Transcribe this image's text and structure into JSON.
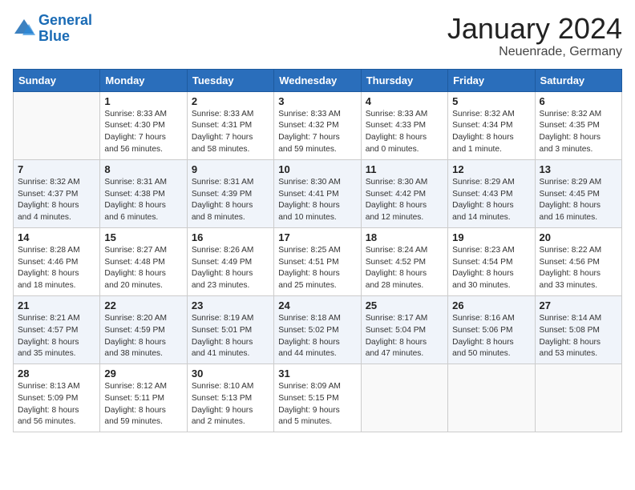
{
  "logo": {
    "line1": "General",
    "line2": "Blue"
  },
  "title": "January 2024",
  "location": "Neuenrade, Germany",
  "weekdays": [
    "Sunday",
    "Monday",
    "Tuesday",
    "Wednesday",
    "Thursday",
    "Friday",
    "Saturday"
  ],
  "weeks": [
    [
      {
        "day": "",
        "info": ""
      },
      {
        "day": "1",
        "info": "Sunrise: 8:33 AM\nSunset: 4:30 PM\nDaylight: 7 hours\nand 56 minutes."
      },
      {
        "day": "2",
        "info": "Sunrise: 8:33 AM\nSunset: 4:31 PM\nDaylight: 7 hours\nand 58 minutes."
      },
      {
        "day": "3",
        "info": "Sunrise: 8:33 AM\nSunset: 4:32 PM\nDaylight: 7 hours\nand 59 minutes."
      },
      {
        "day": "4",
        "info": "Sunrise: 8:33 AM\nSunset: 4:33 PM\nDaylight: 8 hours\nand 0 minutes."
      },
      {
        "day": "5",
        "info": "Sunrise: 8:32 AM\nSunset: 4:34 PM\nDaylight: 8 hours\nand 1 minute."
      },
      {
        "day": "6",
        "info": "Sunrise: 8:32 AM\nSunset: 4:35 PM\nDaylight: 8 hours\nand 3 minutes."
      }
    ],
    [
      {
        "day": "7",
        "info": "Sunrise: 8:32 AM\nSunset: 4:37 PM\nDaylight: 8 hours\nand 4 minutes."
      },
      {
        "day": "8",
        "info": "Sunrise: 8:31 AM\nSunset: 4:38 PM\nDaylight: 8 hours\nand 6 minutes."
      },
      {
        "day": "9",
        "info": "Sunrise: 8:31 AM\nSunset: 4:39 PM\nDaylight: 8 hours\nand 8 minutes."
      },
      {
        "day": "10",
        "info": "Sunrise: 8:30 AM\nSunset: 4:41 PM\nDaylight: 8 hours\nand 10 minutes."
      },
      {
        "day": "11",
        "info": "Sunrise: 8:30 AM\nSunset: 4:42 PM\nDaylight: 8 hours\nand 12 minutes."
      },
      {
        "day": "12",
        "info": "Sunrise: 8:29 AM\nSunset: 4:43 PM\nDaylight: 8 hours\nand 14 minutes."
      },
      {
        "day": "13",
        "info": "Sunrise: 8:29 AM\nSunset: 4:45 PM\nDaylight: 8 hours\nand 16 minutes."
      }
    ],
    [
      {
        "day": "14",
        "info": "Sunrise: 8:28 AM\nSunset: 4:46 PM\nDaylight: 8 hours\nand 18 minutes."
      },
      {
        "day": "15",
        "info": "Sunrise: 8:27 AM\nSunset: 4:48 PM\nDaylight: 8 hours\nand 20 minutes."
      },
      {
        "day": "16",
        "info": "Sunrise: 8:26 AM\nSunset: 4:49 PM\nDaylight: 8 hours\nand 23 minutes."
      },
      {
        "day": "17",
        "info": "Sunrise: 8:25 AM\nSunset: 4:51 PM\nDaylight: 8 hours\nand 25 minutes."
      },
      {
        "day": "18",
        "info": "Sunrise: 8:24 AM\nSunset: 4:52 PM\nDaylight: 8 hours\nand 28 minutes."
      },
      {
        "day": "19",
        "info": "Sunrise: 8:23 AM\nSunset: 4:54 PM\nDaylight: 8 hours\nand 30 minutes."
      },
      {
        "day": "20",
        "info": "Sunrise: 8:22 AM\nSunset: 4:56 PM\nDaylight: 8 hours\nand 33 minutes."
      }
    ],
    [
      {
        "day": "21",
        "info": "Sunrise: 8:21 AM\nSunset: 4:57 PM\nDaylight: 8 hours\nand 35 minutes."
      },
      {
        "day": "22",
        "info": "Sunrise: 8:20 AM\nSunset: 4:59 PM\nDaylight: 8 hours\nand 38 minutes."
      },
      {
        "day": "23",
        "info": "Sunrise: 8:19 AM\nSunset: 5:01 PM\nDaylight: 8 hours\nand 41 minutes."
      },
      {
        "day": "24",
        "info": "Sunrise: 8:18 AM\nSunset: 5:02 PM\nDaylight: 8 hours\nand 44 minutes."
      },
      {
        "day": "25",
        "info": "Sunrise: 8:17 AM\nSunset: 5:04 PM\nDaylight: 8 hours\nand 47 minutes."
      },
      {
        "day": "26",
        "info": "Sunrise: 8:16 AM\nSunset: 5:06 PM\nDaylight: 8 hours\nand 50 minutes."
      },
      {
        "day": "27",
        "info": "Sunrise: 8:14 AM\nSunset: 5:08 PM\nDaylight: 8 hours\nand 53 minutes."
      }
    ],
    [
      {
        "day": "28",
        "info": "Sunrise: 8:13 AM\nSunset: 5:09 PM\nDaylight: 8 hours\nand 56 minutes."
      },
      {
        "day": "29",
        "info": "Sunrise: 8:12 AM\nSunset: 5:11 PM\nDaylight: 8 hours\nand 59 minutes."
      },
      {
        "day": "30",
        "info": "Sunrise: 8:10 AM\nSunset: 5:13 PM\nDaylight: 9 hours\nand 2 minutes."
      },
      {
        "day": "31",
        "info": "Sunrise: 8:09 AM\nSunset: 5:15 PM\nDaylight: 9 hours\nand 5 minutes."
      },
      {
        "day": "",
        "info": ""
      },
      {
        "day": "",
        "info": ""
      },
      {
        "day": "",
        "info": ""
      }
    ]
  ]
}
